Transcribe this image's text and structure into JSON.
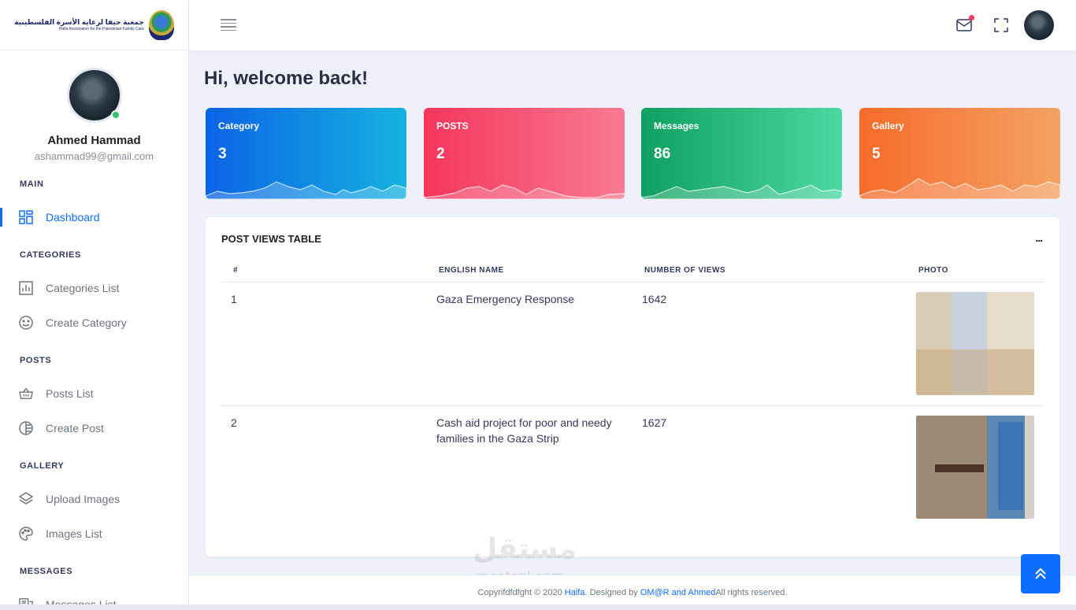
{
  "sidebar": {
    "logo": {
      "arabic": "جمعية حيفا لرعاية الأسرة الفلسطينية",
      "english": "Haifa Association for the Palestinian Family Care"
    },
    "profile": {
      "name": "Ahmed Hammad",
      "email": "ashammad99@gmail.com",
      "status": "online"
    },
    "sections": [
      {
        "header": "MAIN",
        "items": [
          {
            "label": "Dashboard",
            "icon": "dashboard-icon",
            "active": true
          }
        ]
      },
      {
        "header": "CATEGORIES",
        "items": [
          {
            "label": "Categories List",
            "icon": "bar-chart-icon"
          },
          {
            "label": "Create Category",
            "icon": "smile-icon"
          }
        ]
      },
      {
        "header": "POSTS",
        "items": [
          {
            "label": "Posts List",
            "icon": "basket-icon"
          },
          {
            "label": "Create Post",
            "icon": "half-circle-icon"
          }
        ]
      },
      {
        "header": "GALLERY",
        "items": [
          {
            "label": "Upload Images",
            "icon": "layers-icon"
          },
          {
            "label": "Images List",
            "icon": "palette-icon"
          }
        ]
      },
      {
        "header": "MESSAGES",
        "items": [
          {
            "label": "Messages List",
            "icon": "chat-icon"
          }
        ]
      }
    ]
  },
  "topbar": {
    "icons": [
      "menu-icon",
      "mail-icon",
      "fullscreen-icon",
      "user-avatar"
    ],
    "mail_has_notification": true
  },
  "main": {
    "welcome": "Hi, welcome back!",
    "cards": [
      {
        "label": "Category",
        "value": "3",
        "color": "#0b63e5"
      },
      {
        "label": "POSTS",
        "value": "2",
        "color": "#f5365c"
      },
      {
        "label": "Messages",
        "value": "86",
        "color": "#10a062"
      },
      {
        "label": "Gallery",
        "value": "5",
        "color": "#f76b2a"
      }
    ],
    "table": {
      "title": "POST VIEWS TABLE",
      "more": "...",
      "columns": [
        "#",
        "ENGLISH NAME",
        "NUMBER OF VIEWS",
        "PHOTO"
      ],
      "rows": [
        {
          "num": "1",
          "name": "Gaza Emergency Response",
          "views": "1642"
        },
        {
          "num": "2",
          "name": "Cash aid project for poor and needy families in the Gaza Strip",
          "views": "1627"
        }
      ]
    }
  },
  "footer": {
    "prefix": "Copyrifdfdfght © 2020 ",
    "brand": "Haifa",
    "middle": ". Designed by ",
    "designers": "OM@R and Ahmed",
    "suffix": "All rights reserved."
  },
  "watermark": {
    "arabic": "مستقل",
    "latin": "mostaql.com"
  },
  "accent_color": "#0d6efd"
}
